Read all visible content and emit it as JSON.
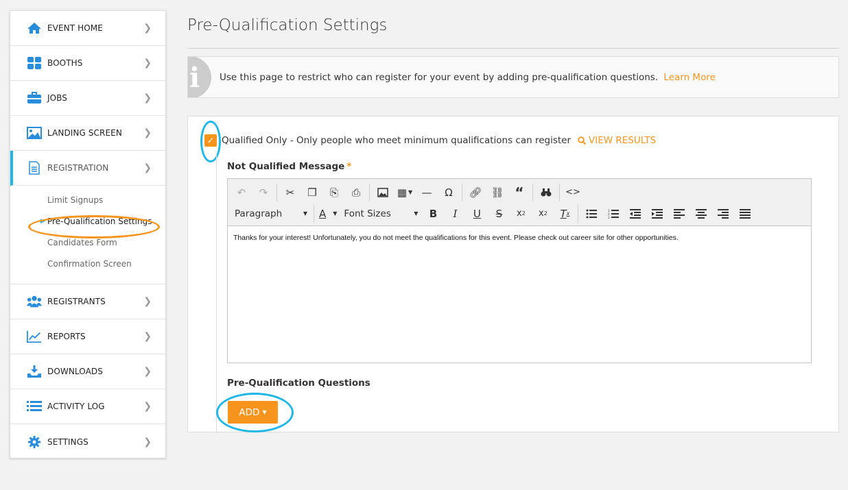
{
  "sidebar": {
    "items": [
      {
        "label": "EVENT HOME",
        "icon": "home-icon"
      },
      {
        "label": "BOOTHS",
        "icon": "grid-icon"
      },
      {
        "label": "JOBS",
        "icon": "briefcase-icon"
      },
      {
        "label": "LANDING SCREEN",
        "icon": "image-icon"
      },
      {
        "label": "REGISTRATION",
        "icon": "document-icon"
      },
      {
        "label": "REGISTRANTS",
        "icon": "users-icon"
      },
      {
        "label": "REPORTS",
        "icon": "chart-icon"
      },
      {
        "label": "DOWNLOADS",
        "icon": "download-icon"
      },
      {
        "label": "ACTIVITY LOG",
        "icon": "list-icon"
      },
      {
        "label": "SETTINGS",
        "icon": "gear-icon"
      }
    ],
    "submenu": [
      "Limit Signups",
      "Pre-Qualification Settings",
      "Candidates Form",
      "Confirmation Screen"
    ]
  },
  "page": {
    "title": "Pre-Qualification Settings"
  },
  "info": {
    "text": "Use this page to restrict who can register for your event by adding pre-qualification questions.",
    "link": "Learn More"
  },
  "qualified": {
    "checked": true,
    "label": "Qualified Only - Only people who meet minimum qualifications can register",
    "view_results": "VIEW RESULTS"
  },
  "message": {
    "label": "Not Qualified Message",
    "required_mark": "*",
    "format_select": "Paragraph",
    "font_size_select": "Font Sizes",
    "body": "Thanks for your interest! Unfortunately, you do not meet the qualifications for this event. Please check out career site for other opportunities."
  },
  "questions": {
    "label": "Pre-Qualification Questions",
    "add_label": "ADD"
  },
  "colors": {
    "accent": "#f7941d",
    "brand_blue": "#2a8ddb",
    "highlight": "#1fb6e8"
  }
}
